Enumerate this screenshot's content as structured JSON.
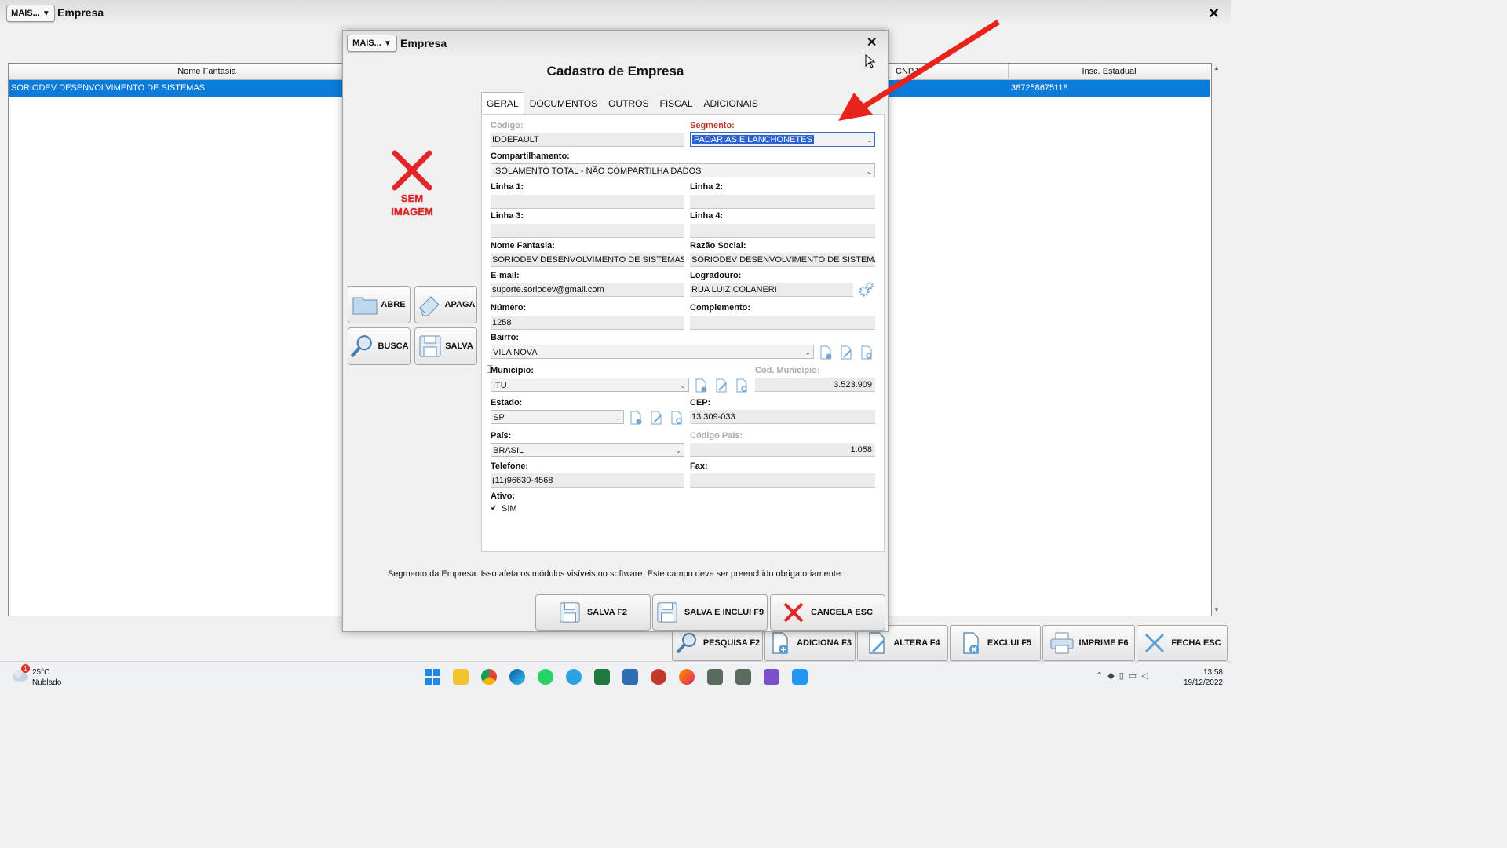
{
  "window": {
    "mais_label": "MAIS...",
    "mais_arrow": "▼",
    "title": "Empresa",
    "close": "✕"
  },
  "grid": {
    "columns": [
      "Nome Fantasia",
      "CNPJ",
      "Insc. Estadual"
    ],
    "row": {
      "nome_fantasia": "SORIODEV DESENVOLVIMENTO DE SISTEMAS",
      "insc_estadual": "387258675118"
    }
  },
  "bottom_buttons": [
    {
      "label": "PESQUISA F2",
      "icon": "magnifier-icon"
    },
    {
      "label": "ADICIONA F3",
      "icon": "add-doc-icon"
    },
    {
      "label": "ALTERA F4",
      "icon": "edit-doc-icon"
    },
    {
      "label": "EXCLUI F5",
      "icon": "delete-doc-icon"
    },
    {
      "label": "IMPRIME F6",
      "icon": "printer-icon"
    },
    {
      "label": "FECHA ESC",
      "icon": "close-x-icon"
    }
  ],
  "dialog": {
    "mais_label": "MAIS...",
    "mais_arrow": "▼",
    "title": "Empresa",
    "close": "✕",
    "heading": "Cadastro de Empresa",
    "no_image": [
      "SEM",
      "IMAGEM"
    ],
    "side_buttons": {
      "abre": "ABRE",
      "apaga": "APAGA",
      "busca": "BUSCA",
      "salva": "SALVA"
    },
    "tabs": [
      "GERAL",
      "DOCUMENTOS",
      "OUTROS",
      "FISCAL",
      "ADICIONAIS"
    ],
    "active_tab": "GERAL",
    "form": {
      "codigo_label": "Código:",
      "codigo": "IDDEFAULT",
      "segmento_label": "Segmento:",
      "segmento": "PADARIAS E LANCHONETES",
      "compart_label": "Compartilhamento:",
      "compart": "ISOLAMENTO TOTAL - NÃO COMPARTILHA DADOS",
      "linha1_label": "Linha 1:",
      "linha2_label": "Linha 2:",
      "linha3_label": "Linha 3:",
      "linha4_label": "Linha 4:",
      "nome_label": "Nome Fantasia:",
      "nome": "SORIODEV DESENVOLVIMENTO DE SISTEMAS",
      "razao_label": "Razão Social:",
      "razao": "SORIODEV DESENVOLVIMENTO DE SISTEMA",
      "email_label": "E-mail:",
      "email": "suporte.soriodev@gmail.com",
      "logradouro_label": "Logradouro:",
      "logradouro": "RUA LUIZ COLANERI",
      "numero_label": "Número:",
      "numero": "1258",
      "complemento_label": "Complemento:",
      "bairro_label": "Bairro:",
      "bairro": "VILA NOVA",
      "municipio_label": "Município:",
      "municipio": "ITU",
      "cod_mun_label": "Cód. Município:",
      "cod_mun": "3.523.909",
      "estado_label": "Estado:",
      "estado": "SP",
      "cep_label": "CEP:",
      "cep": "13.309-033",
      "pais_label": "País:",
      "pais": "BRASIL",
      "cod_pais_label": "Código País:",
      "cod_pais": "1.058",
      "telefone_label": "Telefone:",
      "telefone": "(11)96630-4568",
      "fax_label": "Fax:",
      "ativo_label": "Ativo:",
      "ativo_check": "✔",
      "ativo": "SIM"
    },
    "hint": "Segmento da Empresa. Isso afeta os módulos visíveis no software. Este campo deve ser preenchido obrigatoriamente.",
    "footer_buttons": {
      "salva": "SALVA F2",
      "salva_inclui": "SALVA E INCLUI F9",
      "cancela": "CANCELA ESC"
    }
  },
  "taskbar": {
    "temp": "25°C",
    "weather": "Nublado",
    "badge": "1",
    "time": "13:58",
    "date": "19/12/2022"
  },
  "colors": {
    "selection": "#0a7bd9",
    "required_label": "#c0392b",
    "annotation_arrow": "#e8231c"
  }
}
